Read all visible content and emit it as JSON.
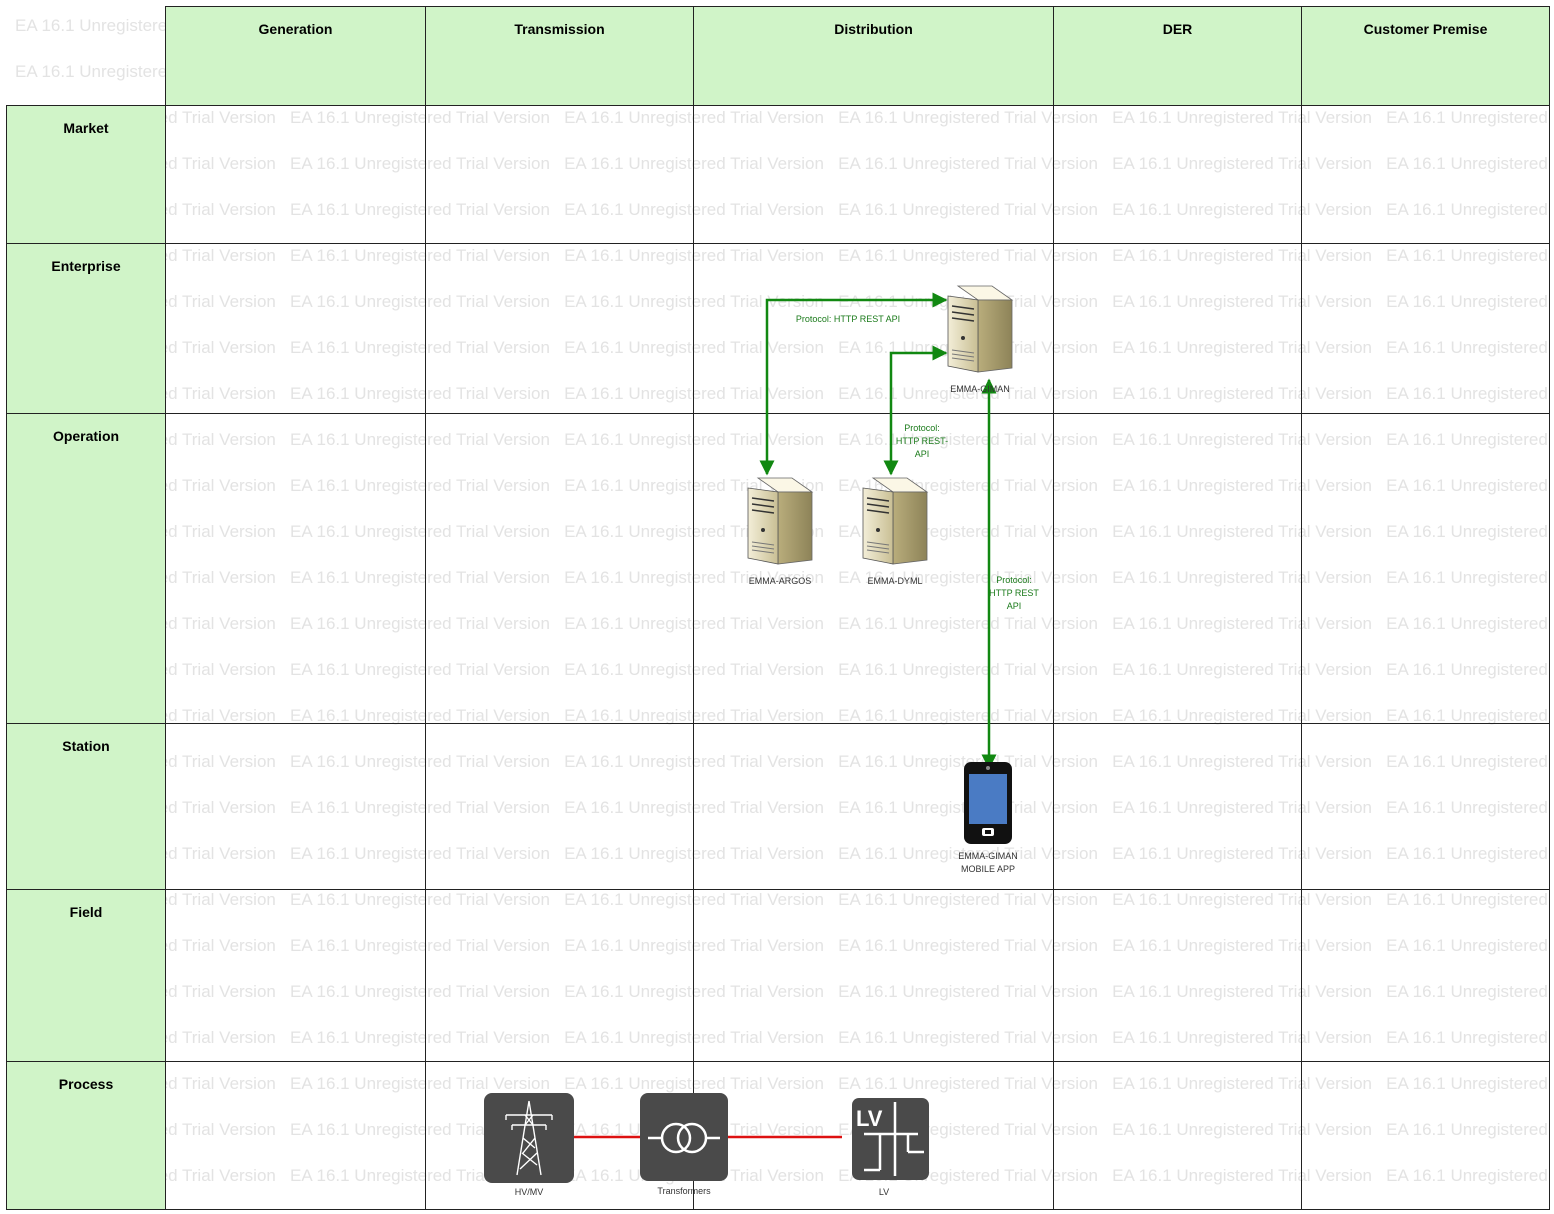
{
  "watermark": {
    "text": "EA 16.1 Unregistered Trial Version"
  },
  "columns": [
    {
      "id": "generation",
      "label": "Generation"
    },
    {
      "id": "transmission",
      "label": "Transmission"
    },
    {
      "id": "distribution",
      "label": "Distribution"
    },
    {
      "id": "der",
      "label": "DER"
    },
    {
      "id": "customer-premise",
      "label": "Customer Premise"
    }
  ],
  "rows": [
    {
      "id": "market",
      "label": "Market"
    },
    {
      "id": "enterprise",
      "label": "Enterprise"
    },
    {
      "id": "operation",
      "label": "Operation"
    },
    {
      "id": "station",
      "label": "Station"
    },
    {
      "id": "field",
      "label": "Field"
    },
    {
      "id": "process",
      "label": "Process"
    }
  ],
  "nodes": {
    "giman": {
      "label": "EMMA-GIMAN",
      "icon": "server-icon"
    },
    "argos": {
      "label": "EMMA-ARGOS",
      "icon": "server-icon"
    },
    "dyml": {
      "label": "EMMA-DYML",
      "icon": "server-icon"
    },
    "mobile": {
      "label_line1": "EMMA-GIMAN",
      "label_line2": "MOBILE APP",
      "icon": "smartphone-icon"
    },
    "hvmv": {
      "label": "HV/MV",
      "icon": "power-tower-icon"
    },
    "transformers": {
      "label": "Transformers",
      "icon": "transformer-icon"
    },
    "lv": {
      "label": "LV",
      "icon": "lv-network-icon"
    }
  },
  "connections": {
    "argos_giman": {
      "protocol": "Protocol: HTTP REST API"
    },
    "dyml_giman": {
      "line1": "Protocol:",
      "line2": "HTTP REST-",
      "line3": "API"
    },
    "mobile_giman": {
      "line1": "Protocol:",
      "line2": "HTTP REST",
      "line3": "API"
    }
  },
  "colors": {
    "header_fill": "#d0f4c8",
    "connector": "#118811",
    "power_line": "#dd1111",
    "icon_dark": "#4a4a4a"
  }
}
